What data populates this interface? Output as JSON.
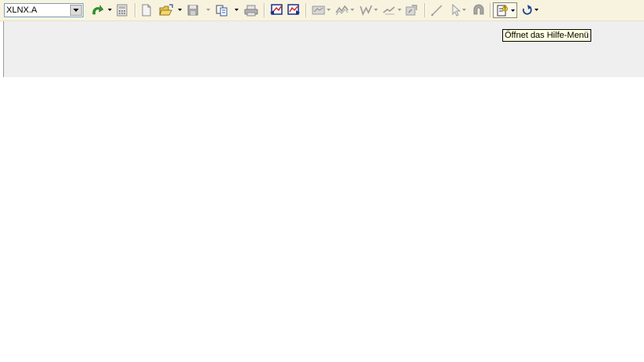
{
  "symbol_selector": {
    "value": "XLNX.A"
  },
  "toolbar": {
    "icons": [
      "refresh-arrow-icon",
      "calculator-icon",
      "new-document-icon",
      "open-folder-icon",
      "save-disk-icon",
      "copy-icon",
      "print-icon",
      "chart-back-icon",
      "chart-forward-icon",
      "chart-type-icon",
      "indicator-icon",
      "study-icon",
      "drawing-icon",
      "properties-icon",
      "line-tool-icon",
      "cursor-icon",
      "magnet-icon",
      "help-icon",
      "undo-icon"
    ]
  },
  "tooltip": {
    "text": "Öffnet das Hilfe-Menü"
  }
}
